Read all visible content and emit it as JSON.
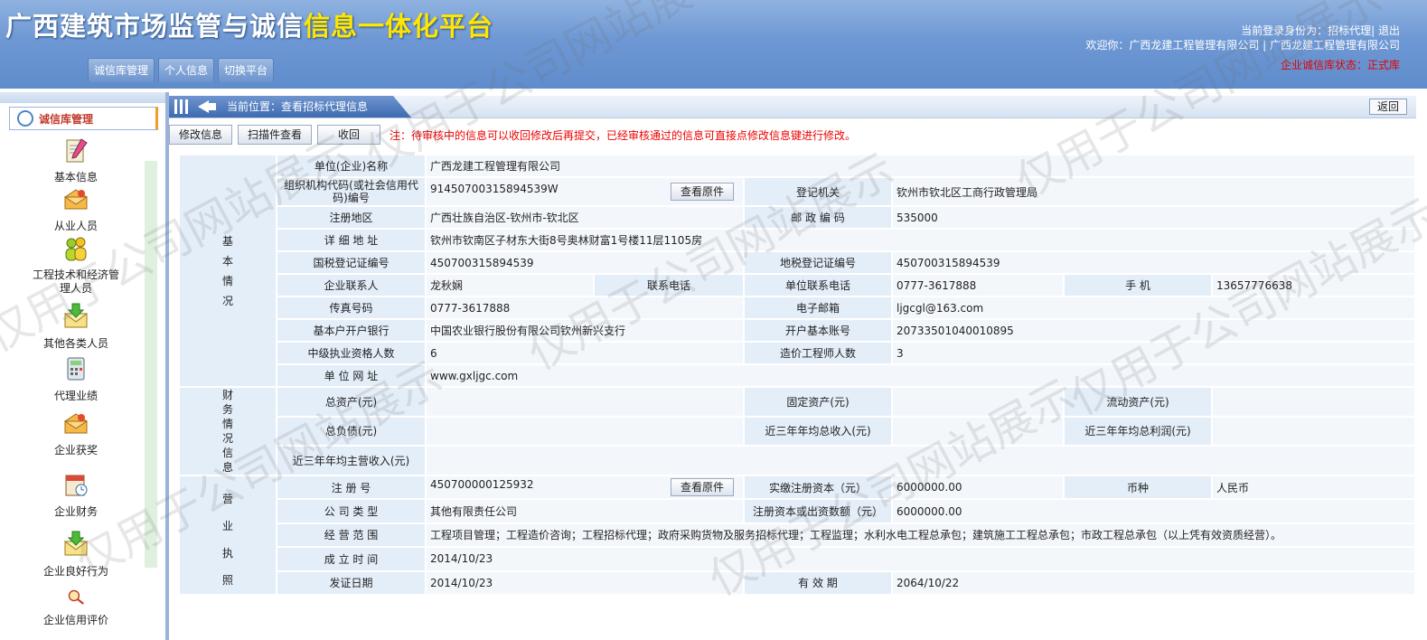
{
  "header": {
    "title_main": "广西建筑市场监管与诚信",
    "title_highlight": "信息一体化平台",
    "login_identity": "当前登录身份为：招标代理| 退出",
    "welcome": "欢迎你：广西龙建工程管理有限公司  | 广西龙建工程管理有限公司",
    "status": "企业诚信库状态：正式库"
  },
  "nav": {
    "tabs": [
      "诚信库管理",
      "个人信息",
      "切换平台"
    ]
  },
  "sidebar": {
    "title": "诚信库管理",
    "items": [
      {
        "label": "基本信息",
        "icon": "pencil-document-icon"
      },
      {
        "label": "从业人员",
        "icon": "envelope-icon"
      },
      {
        "label": "工程技术和经济管理人员",
        "icon": "users-icon"
      },
      {
        "label": "其他各类人员",
        "icon": "download-envelope-icon"
      },
      {
        "label": "代理业绩",
        "icon": "calculator-icon"
      },
      {
        "label": "企业获奖",
        "icon": "envelope-icon"
      },
      {
        "label": "企业财务",
        "icon": "calendar-icon"
      },
      {
        "label": "企业良好行为",
        "icon": "download-envelope-icon"
      },
      {
        "label": "企业信用评价",
        "icon": "magnifier-icon"
      }
    ]
  },
  "breadcrumb": "当前位置：查看招标代理信息",
  "back_label": "返回",
  "toolbar": {
    "modify": "修改信息",
    "scan": "扫描件查看",
    "withdraw": "收回",
    "notice": "注：待审核中的信息可以收回修改后再提交，已经审核通过的信息可直接点修改信息键进行修改。"
  },
  "view_original": "查看原件",
  "sections": {
    "basic": "基\n本\n情\n况",
    "finance": "财\n务\n情\n况\n信\n息",
    "license": "营\n业\n执\n照"
  },
  "basic": {
    "company_name_label": "单位(企业)名称",
    "company_name": "广西龙建工程管理有限公司",
    "org_code_label": "组织机构代码(或社会信用代码)编号",
    "org_code": "91450700315894539W",
    "reg_authority_label": "登记机关",
    "reg_authority": "钦州市钦北区工商行政管理局",
    "reg_area_label": "注册地区",
    "reg_area": "广西壮族自治区-钦州市-钦北区",
    "postcode_label": "邮 政 编 码",
    "postcode": "535000",
    "address_label": "详 细 地 址",
    "address": "钦州市钦南区子材东大街8号奥林财富1号楼11层1105房",
    "national_tax_label": "国税登记证编号",
    "national_tax": "450700315894539",
    "local_tax_label": "地税登记证编号",
    "local_tax": "450700315894539",
    "contact_label": "企业联系人",
    "contact": "龙秋娴",
    "contact_phone_label": "联系电话",
    "contact_phone": "",
    "unit_phone_label": "单位联系电话",
    "unit_phone": "0777-3617888",
    "mobile_label": "手  机",
    "mobile": "13657776638",
    "fax_label": "传真号码",
    "fax": "0777-3617888",
    "email_label": "电子邮箱",
    "email": "ljgcgl@163.com",
    "bank_label": "基本户开户银行",
    "bank": "中国农业银行股份有限公司钦州新兴支行",
    "account_label": "开户基本账号",
    "account": "20733501040010895",
    "mid_qual_label": "中级执业资格人数",
    "mid_qual": "6",
    "cost_engineer_label": "造价工程师人数",
    "cost_engineer": "3",
    "website_label": "单 位 网 址",
    "website": "www.gxljgc.com"
  },
  "finance": {
    "total_assets_label": "总资产(元)",
    "fixed_assets_label": "固定资产(元)",
    "current_assets_label": "流动资产(元)",
    "total_liabilities_label": "总负债(元)",
    "avg_income_label": "近三年年均总收入(元)",
    "avg_profit_label": "近三年年均总利润(元)",
    "avg_main_income_label": "近三年年均主营收入(元)"
  },
  "license": {
    "reg_no_label": "注 册 号",
    "reg_no": "450700000125932",
    "paid_capital_label": "实缴注册资本（元）",
    "paid_capital": "6000000.00",
    "currency_label": "币种",
    "currency": "人民币",
    "company_type_label": "公 司 类 型",
    "company_type": "其他有限责任公司",
    "reg_capital_label": "注册资本或出资数额（元）",
    "reg_capital": "6000000.00",
    "scope_label": "经 营 范 围",
    "scope": "工程项目管理；工程造价咨询；工程招标代理；政府采购货物及服务招标代理；工程监理；水利水电工程总承包；建筑施工工程总承包；市政工程总承包（以上凭有效资质经营）。",
    "founded_label": "成 立 时 间",
    "founded": "2014/10/23",
    "issue_date_label": "发证日期",
    "issue_date": "2014/10/23",
    "valid_label": "有 效 期",
    "valid": "2064/10/22"
  },
  "watermark_text": "仅用于公司网站展示",
  "colors": {
    "header_blue": "#6e98d4",
    "highlight_yellow": "#ffe600",
    "notice_red": "#e00000",
    "cell_bg": "#f1f6fc"
  }
}
